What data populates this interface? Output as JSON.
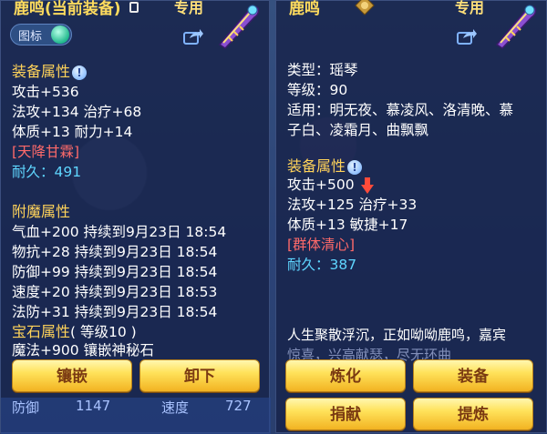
{
  "left": {
    "title": "鹿鸣",
    "title_sub": "(当前装备)",
    "equip_tag": "专用",
    "toggle_label": "图标",
    "attr_header": "装备属性",
    "base_attrs": [
      "攻击+536",
      "法攻+134 治疗+68",
      "体质+13 耐力+14"
    ],
    "special": "[天降甘霖]",
    "durability": "耐久：491",
    "enchant_header": "附魔属性",
    "enchants": [
      "气血+200 持续到9月23日 18:54",
      "物抗+28 持续到9月23日 18:54",
      "防御+99 持续到9月23日 18:54",
      "速度+20 持续到9月23日 18:53",
      "法防+31 持续到9月23日 18:54"
    ],
    "gem_header": "宝石属性",
    "gem_level": "( 等级10 )",
    "gem_line": "魔法+900 镶嵌神秘石",
    "btn_inlay": "镶嵌",
    "btn_unequip": "卸下",
    "bottom": [
      "防御",
      "1147",
      "速度",
      "727"
    ]
  },
  "right": {
    "title": "鹿鸣",
    "equip_tag": "专用",
    "type": "类型：瑶琴",
    "level": "等级：90",
    "usage1": "适用：明无夜、慕凌风、洛清晚、慕",
    "usage2": "子白、凌霜月、曲飘飘",
    "attr_header": "装备属性",
    "base_attrs": [
      "攻击+500",
      "法攻+125 治疗+33",
      "体质+13 敏捷+17"
    ],
    "special": "[群体清心]",
    "durability": "耐久：387",
    "desc1": "人生聚散浮沉，正如呦呦鹿鸣，嘉宾",
    "desc2": "惊喜，兴高献瑟，尽无环曲",
    "btn_refine": "炼化",
    "btn_equip": "装备",
    "btn_donate": "捐献",
    "btn_extract": "提炼"
  },
  "colors": {
    "gold": "#ffd35a",
    "red": "#ff6a6a",
    "cyan": "#5fd6ff",
    "btn": "#ffe25a"
  },
  "icons": [
    "lock-icon",
    "share-icon",
    "qin-item-icon",
    "info-icon",
    "down-arrow-icon",
    "seal-icon",
    "toggle-knob-icon"
  ]
}
